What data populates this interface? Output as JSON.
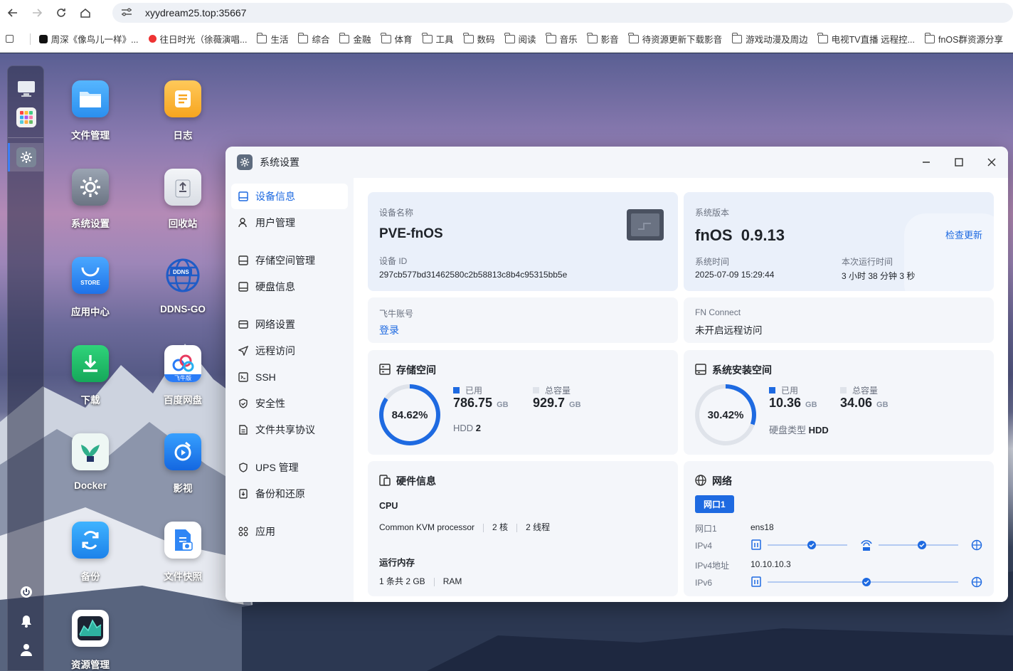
{
  "browser": {
    "url": "xyydream25.top:35667",
    "bookmarks": [
      "周深《像鸟儿一样》...",
      "往日时光（徐薇演唱...",
      "生活",
      "综合",
      "金融",
      "体育",
      "工具",
      "数码",
      "阅读",
      "音乐",
      "影音",
      "待资源更新下载影音",
      "游戏动漫及周边",
      "电视TV直播 远程控...",
      "fnOS群资源分享"
    ]
  },
  "desktop": {
    "apps": [
      {
        "label": "文件管理"
      },
      {
        "label": "日志"
      },
      {
        "label": "系统设置"
      },
      {
        "label": "回收站"
      },
      {
        "label": "应用中心",
        "badge": "STORE"
      },
      {
        "label": "DDNS-GO",
        "badge": "DDNS"
      },
      {
        "label": "下载"
      },
      {
        "label": "百度网盘",
        "badge": "飞牛版"
      },
      {
        "label": "Docker"
      },
      {
        "label": "影视"
      },
      {
        "label": "备份"
      },
      {
        "label": "文件快照"
      },
      {
        "label": "资源管理"
      }
    ]
  },
  "window": {
    "title": "系统设置",
    "sidebar": [
      {
        "label": "设备信息"
      },
      {
        "label": "用户管理"
      },
      {
        "label": "存储空间管理"
      },
      {
        "label": "硬盘信息"
      },
      {
        "label": "网络设置"
      },
      {
        "label": "远程访问"
      },
      {
        "label": "SSH"
      },
      {
        "label": "安全性"
      },
      {
        "label": "文件共享协议"
      },
      {
        "label": "UPS 管理"
      },
      {
        "label": "备份和还原"
      },
      {
        "label": "应用"
      }
    ],
    "device": {
      "name_label": "设备名称",
      "name": "PVE-fnOS",
      "id_label": "设备 ID",
      "id": "297cb577bd31462580c2b58813c8b4c95315bb5e"
    },
    "system": {
      "version_label": "系统版本",
      "version_name": "fnOS",
      "version": "0.9.13",
      "check_update": "检查更新",
      "time_label": "系统时间",
      "time": "2025-07-09 15:29:44",
      "uptime_label": "本次运行时间",
      "uptime": "3 小时 38 分钟 3 秒"
    },
    "account": {
      "label": "飞牛账号",
      "login": "登录"
    },
    "fnconnect": {
      "label": "FN Connect",
      "status": "未开启远程访问"
    },
    "storage": {
      "title": "存储空间",
      "percent": "84.62%",
      "percent_value": 84.62,
      "used_label": "已用",
      "used": "786.75",
      "used_unit": "GB",
      "total_label": "总容量",
      "total": "929.7",
      "total_unit": "GB",
      "disk_type": "HDD",
      "disk_count": "2"
    },
    "sys_storage": {
      "title": "系统安装空间",
      "percent": "30.42%",
      "percent_value": 30.42,
      "used_label": "已用",
      "used": "10.36",
      "used_unit": "GB",
      "total_label": "总容量",
      "total": "34.06",
      "total_unit": "GB",
      "disk_type_label": "硬盘类型",
      "disk_type": "HDD"
    },
    "hardware": {
      "title": "硬件信息",
      "cpu_label": "CPU",
      "cpu_model": "Common KVM processor",
      "cores": "2 核",
      "threads": "2 线程",
      "mem_label": "运行内存",
      "mem": "1 条共 2 GB",
      "mem_type": "RAM"
    },
    "network": {
      "title": "网络",
      "tab": "网口1",
      "port_label": "网口1",
      "port": "ens18",
      "ipv4_label": "IPv4",
      "ipv4_addr_label": "IPv4地址",
      "ipv4_addr": "10.10.10.3",
      "ipv6_label": "IPv6"
    }
  },
  "colors": {
    "accent": "#1e6ae1",
    "ring_track": "#dfe3ea"
  }
}
